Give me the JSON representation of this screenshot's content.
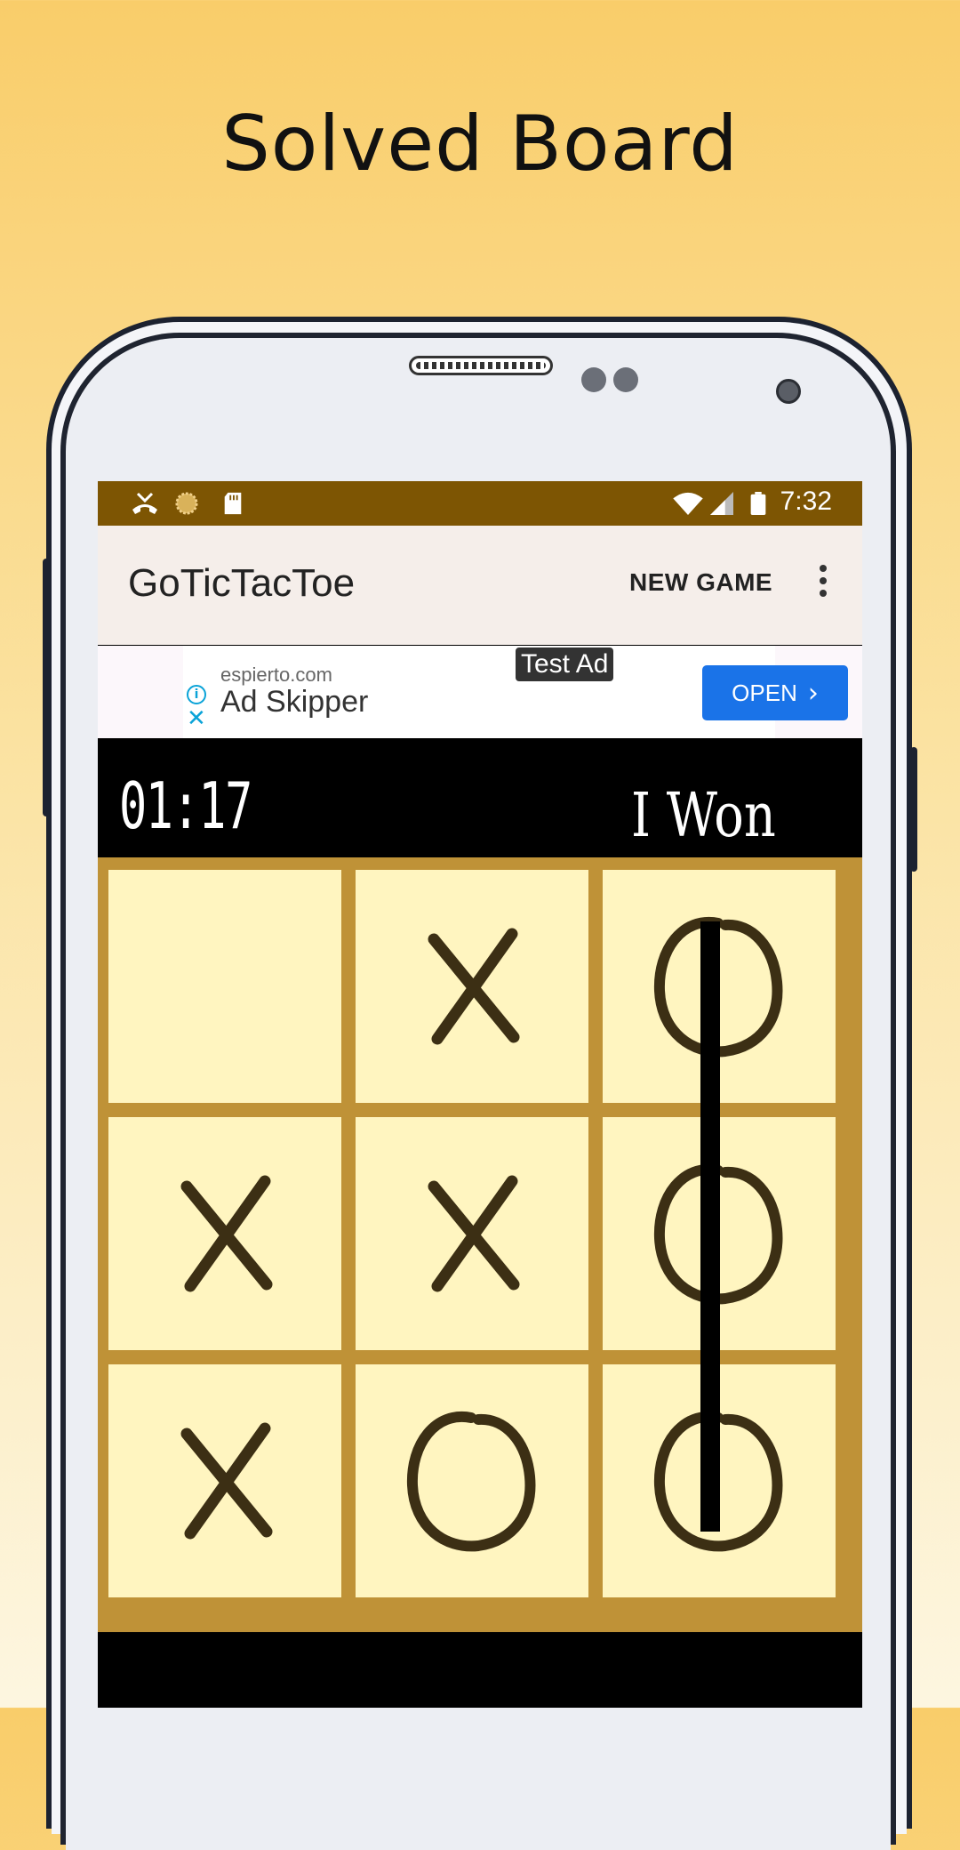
{
  "headline": "Solved Board",
  "status_bar": {
    "time": "7:32",
    "icons": [
      "missed-call-icon",
      "loading-icon",
      "sd-card-icon",
      "wifi-icon",
      "signal-icon",
      "battery-icon"
    ]
  },
  "app_bar": {
    "title": "GoTicTacToe",
    "new_game_label": "NEW GAME",
    "menu_icon": "overflow-menu-icon"
  },
  "ad": {
    "test_label": "Test Ad",
    "domain": "espierto.com",
    "name": "Ad Skipper",
    "open_label": "OPEN",
    "info_icon": "i",
    "close_icon": "✕",
    "chevron_icon": "›"
  },
  "game": {
    "timer": "01:17",
    "status": "I Won",
    "board": [
      [
        "",
        "X",
        "O"
      ],
      [
        "X",
        "X",
        "O"
      ],
      [
        "X",
        "O",
        "O"
      ]
    ],
    "winning_line": "column-3"
  },
  "colors": {
    "status_bar": "#7d5503",
    "app_bar": "#f5eeea",
    "board_frame": "#bf9237",
    "cell": "#fff5c0",
    "mark": "#3c2f14",
    "open_button": "#1a73e8"
  }
}
